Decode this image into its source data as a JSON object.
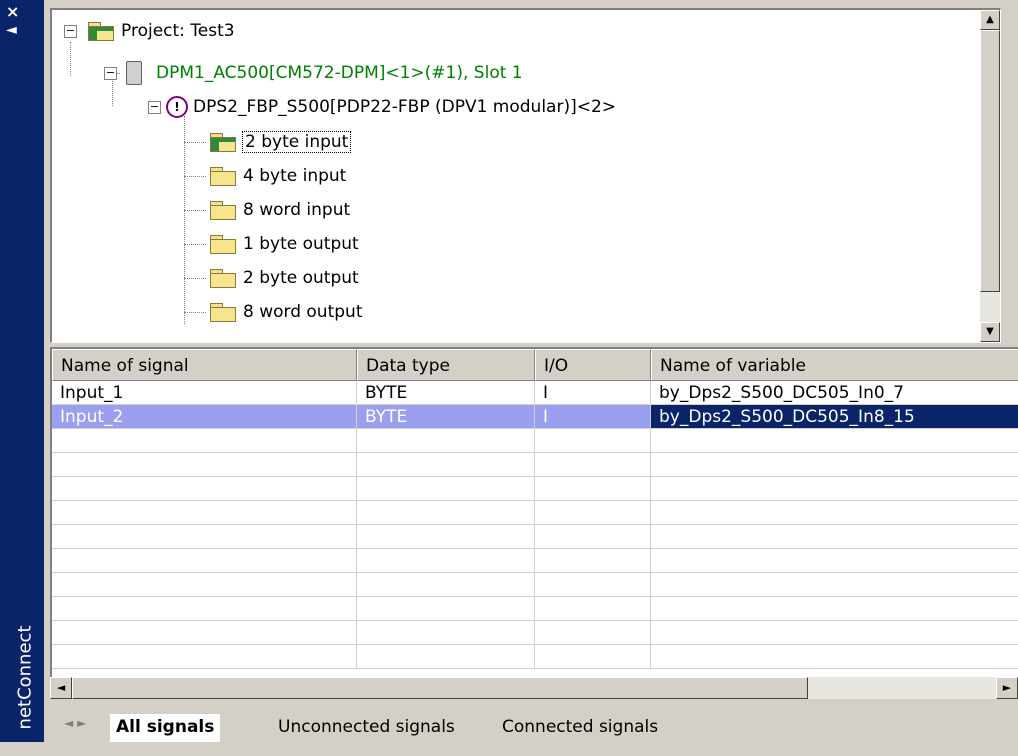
{
  "sidebar": {
    "close_glyph": "×",
    "collapse_glyph": "◄",
    "label": "netConnect"
  },
  "tree": {
    "project": "Project: Test3",
    "master": "DPM1_AC500[CM572-DPM]<1>(#1), Slot 1",
    "slave": "DPS2_FBP_S500[PDP22-FBP (DPV1 modular)]<2>",
    "modules": [
      "2 byte input",
      "4 byte input",
      "8 word input",
      "1 byte output",
      "2 byte output",
      "8 word output"
    ],
    "selected_module": "2 byte input",
    "master_color": "#008000",
    "expander_minus": "−"
  },
  "table": {
    "headers": [
      "Name of signal",
      "Data type",
      "I/O",
      "Name of variable"
    ],
    "rows": [
      [
        "Input_1",
        "BYTE",
        "I",
        "by_Dps2_S500_DC505_In0_7"
      ],
      [
        "Input_2",
        "BYTE",
        "I",
        "by_Dps2_S500_DC505_In8_15"
      ]
    ],
    "selected_row": 1,
    "selection_color": "#0a246a"
  },
  "tabs": {
    "items": [
      "All signals",
      "Unconnected signals",
      "Connected signals"
    ],
    "active": "All signals"
  },
  "icons": {
    "scroll_up": "▲",
    "scroll_down": "▼",
    "scroll_left": "◄",
    "scroll_right": "►",
    "tab_prev": "◄",
    "tab_next": "►"
  }
}
